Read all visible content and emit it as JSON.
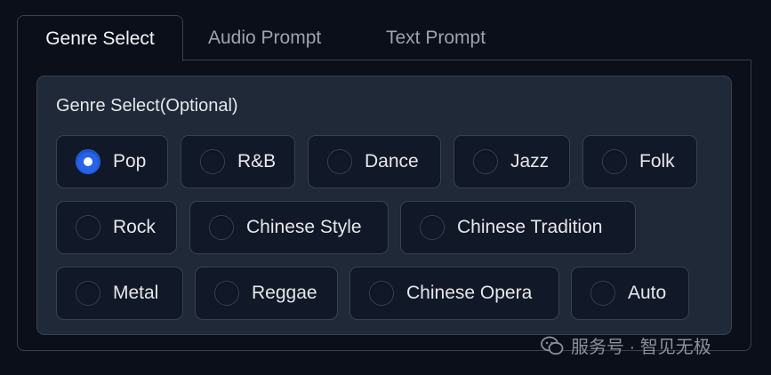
{
  "tabs": [
    {
      "label": "Genre Select",
      "active": true
    },
    {
      "label": "Audio Prompt",
      "active": false
    },
    {
      "label": "Text Prompt",
      "active": false
    }
  ],
  "genre": {
    "label": "Genre Select(Optional)",
    "selected": "Pop",
    "options": [
      "Pop",
      "R&B",
      "Dance",
      "Jazz",
      "Folk",
      "Rock",
      "Chinese Style",
      "Chinese Tradition",
      "Metal",
      "Reggae",
      "Chinese Opera",
      "Auto"
    ]
  },
  "watermark": "服务号 · 智见无极",
  "colors": {
    "accent": "#2563eb",
    "background": "#0b0f19",
    "panel": "#1f2937"
  }
}
